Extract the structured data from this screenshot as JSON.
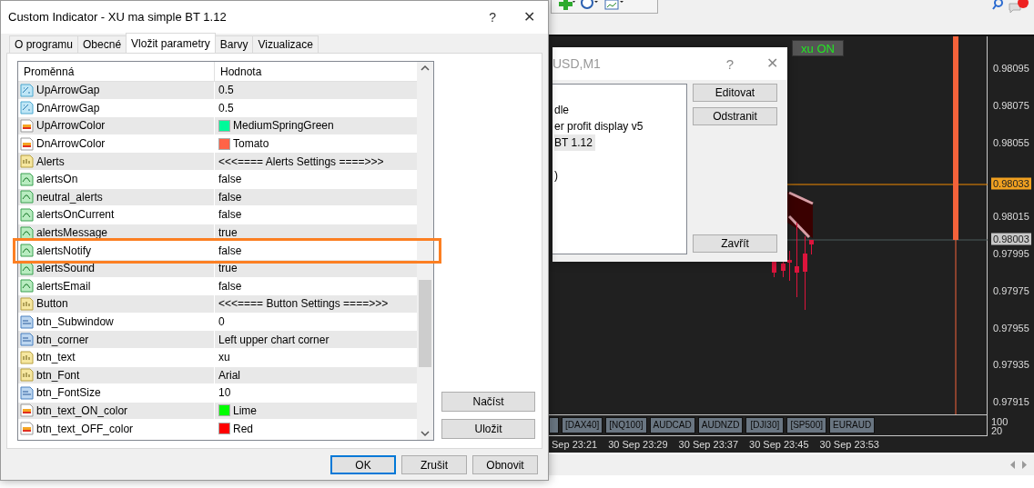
{
  "dialog": {
    "title": "Custom Indicator - XU ma simple BT 1.12",
    "help_button": "?",
    "close_button": "✕",
    "tabs": [
      {
        "label": "O programu",
        "selected": false
      },
      {
        "label": "Obecné",
        "selected": false
      },
      {
        "label": "Vložit parametry",
        "selected": true
      },
      {
        "label": "Barvy",
        "selected": false
      },
      {
        "label": "Vizualizace",
        "selected": false
      }
    ],
    "columns": [
      "Proměnná",
      "Hodnota"
    ],
    "rows": [
      {
        "kind": "double",
        "name": "UpArrowGap",
        "value": "0.5",
        "highlighted": false
      },
      {
        "kind": "double",
        "name": "DnArrowGap",
        "value": "0.5",
        "highlighted": false
      },
      {
        "kind": "color",
        "name": "UpArrowColor",
        "value": "MediumSpringGreen",
        "color": "#00fa9a",
        "highlighted": false
      },
      {
        "kind": "color",
        "name": "DnArrowColor",
        "value": "Tomato",
        "color": "#ff6347",
        "highlighted": false
      },
      {
        "kind": "string",
        "name": "Alerts",
        "value": "<<<====  Alerts Settings ====>>>",
        "highlighted": false
      },
      {
        "kind": "bool",
        "name": "alertsOn",
        "value": "false",
        "highlighted": false
      },
      {
        "kind": "bool",
        "name": "neutral_alerts",
        "value": "false",
        "highlighted": false
      },
      {
        "kind": "bool",
        "name": "alertsOnCurrent",
        "value": "false",
        "highlighted": false
      },
      {
        "kind": "bool",
        "name": "alertsMessage",
        "value": "true",
        "highlighted": false
      },
      {
        "kind": "bool",
        "name": "alertsNotify",
        "value": "false",
        "highlighted": true
      },
      {
        "kind": "bool",
        "name": "alertsSound",
        "value": "true",
        "highlighted": false
      },
      {
        "kind": "bool",
        "name": "alertsEmail",
        "value": "false",
        "highlighted": false
      },
      {
        "kind": "string",
        "name": "Button",
        "value": "<<<====  Button Settings ====>>>",
        "highlighted": false
      },
      {
        "kind": "int",
        "name": "btn_Subwindow",
        "value": "0",
        "highlighted": false
      },
      {
        "kind": "int",
        "name": "btn_corner",
        "value": "Left upper chart corner",
        "highlighted": false
      },
      {
        "kind": "string",
        "name": "btn_text",
        "value": "xu",
        "highlighted": false
      },
      {
        "kind": "string",
        "name": "btn_Font",
        "value": "Arial",
        "highlighted": false
      },
      {
        "kind": "int",
        "name": "btn_FontSize",
        "value": "10",
        "highlighted": false
      },
      {
        "kind": "color",
        "name": "btn_text_ON_color",
        "value": "Lime",
        "color": "#00ff00",
        "highlighted": false
      },
      {
        "kind": "color",
        "name": "btn_text_OFF_color",
        "value": "Red",
        "color": "#ff0000",
        "highlighted": false
      }
    ],
    "side_buttons": [
      "Načíst",
      "Uložit"
    ],
    "buttons": [
      {
        "label": "OK",
        "default": true
      },
      {
        "label": "Zrušit",
        "default": false
      },
      {
        "label": "Obnovit",
        "default": false
      }
    ]
  },
  "back_dialog": {
    "title": "USD,M1",
    "help_button": "?",
    "close_button": "✕",
    "list": [
      {
        "text": "dle",
        "selected": false
      },
      {
        "text": "er profit display v5",
        "selected": false
      },
      {
        "text": "BT 1.12",
        "selected": true
      },
      {
        "text": ")",
        "selected": false
      }
    ],
    "buttons": [
      "Editovat",
      "Odstranit"
    ],
    "close": "Zavřít"
  },
  "chart": {
    "toggle_button": "xu ON",
    "price_labels": [
      {
        "text": "0.98095",
        "kind": "tick"
      },
      {
        "text": "0.98075",
        "kind": "tick"
      },
      {
        "text": "0.98055",
        "kind": "tick"
      },
      {
        "text": "0.98033",
        "kind": "bid"
      },
      {
        "text": "0.98015",
        "kind": "tick"
      },
      {
        "text": "0.98003",
        "kind": "line"
      },
      {
        "text": "0.97995",
        "kind": "tick"
      },
      {
        "text": "0.97975",
        "kind": "tick"
      },
      {
        "text": "0.97955",
        "kind": "tick"
      },
      {
        "text": "0.97935",
        "kind": "tick"
      },
      {
        "text": "0.97915",
        "kind": "tick"
      }
    ],
    "symbol_buttons": [
      "[DAX40]",
      "[NQ100]",
      "AUDCAD",
      "AUDNZD",
      "[DJI30]",
      "[SP500]",
      "EURAUD"
    ],
    "volume_labels": [
      "100",
      "20"
    ],
    "time_labels": [
      "Sep 23:21",
      "30 Sep 23:29",
      "30 Sep 23:37",
      "30 Sep 23:45",
      "30 Sep 23:53"
    ]
  }
}
